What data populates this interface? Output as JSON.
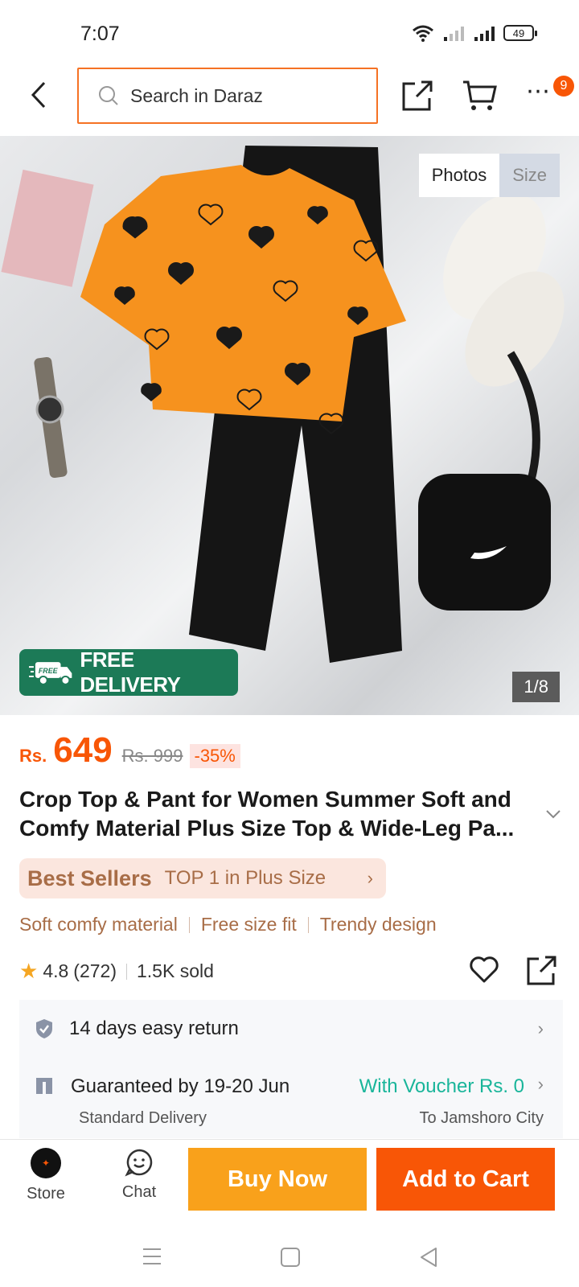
{
  "status_bar": {
    "time": "7:07",
    "battery": "49"
  },
  "top_nav": {
    "search_placeholder": "Search in Daraz",
    "cart_badge": "9"
  },
  "image": {
    "tabs": [
      "Photos",
      "Size"
    ],
    "free_delivery_badge": "FREE",
    "free_delivery_label": "FREE DELIVERY",
    "counter": "1/8"
  },
  "product": {
    "currency": "Rs.",
    "price": "649",
    "original_price": "Rs. 999",
    "discount": "-35%",
    "title": "Crop Top & Pant for Women Summer Soft and Comfy Material Plus Size Top & Wide-Leg Pa...",
    "best_sellers_label": "Best Sellers",
    "best_sellers_rank": "TOP 1 in Plus Size",
    "features": [
      "Soft comfy material",
      "Free size fit",
      "Trendy design"
    ],
    "rating": "4.8",
    "rating_count": "(272)",
    "sold": "1.5K sold"
  },
  "service": {
    "return_policy": "14 days easy return",
    "delivery_guarantee": "Guaranteed by 19-20 Jun",
    "voucher": "With Voucher Rs. 0",
    "delivery_type": "Standard Delivery",
    "delivery_city": "To Jamshoro City"
  },
  "actions": {
    "store": "Store",
    "chat": "Chat",
    "buy_now": "Buy Now",
    "add_to_cart": "Add to Cart"
  },
  "colors": {
    "brand_orange": "#f85606",
    "buy_now_yellow": "#f9a11b",
    "free_delivery_green": "#1c7a57",
    "voucher_teal": "#19b59a"
  }
}
